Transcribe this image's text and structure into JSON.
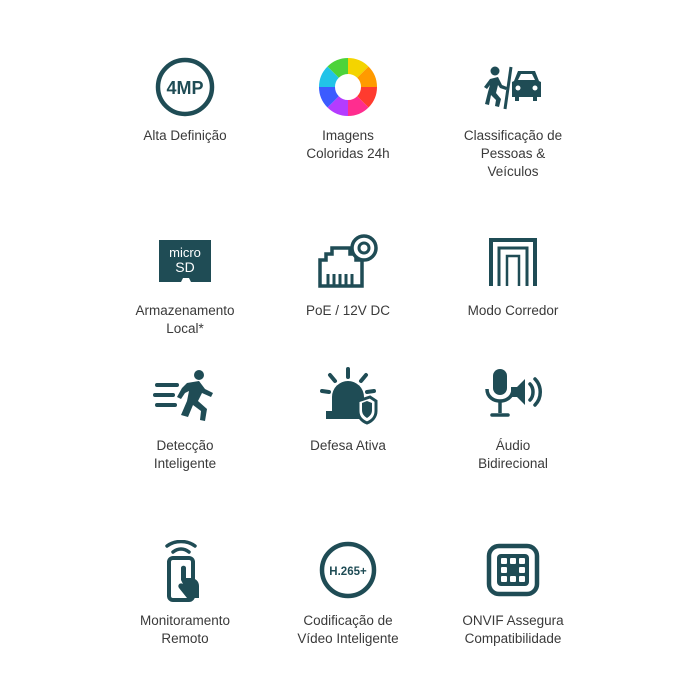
{
  "theme": {
    "icon_color": "#1f4c55"
  },
  "features": [
    {
      "label": "Alta Definição",
      "icon": "4mp-icon",
      "icon_text": "4MP"
    },
    {
      "label": "Imagens\nColoridas 24h",
      "icon": "color-wheel-icon"
    },
    {
      "label": "Classificação de\nPessoas &\nVeículos",
      "icon": "person-vehicle-icon"
    },
    {
      "label": "Armazenamento\nLocal*",
      "icon": "microsd-icon",
      "icon_text_1": "micro",
      "icon_text_2": "SD"
    },
    {
      "label": "PoE / 12V DC",
      "icon": "ethernet-port-icon"
    },
    {
      "label": "Modo Corredor",
      "icon": "corridor-icon"
    },
    {
      "label": "Detecção\nInteligente",
      "icon": "running-person-icon"
    },
    {
      "label": "Defesa Ativa",
      "icon": "alarm-siren-icon"
    },
    {
      "label": "Áudio\nBidirecional",
      "icon": "microphone-speaker-icon"
    },
    {
      "label": "Monitoramento\nRemoto",
      "icon": "phone-signal-icon"
    },
    {
      "label": "Codificação de\nVídeo Inteligente",
      "icon": "h265-icon",
      "icon_text": "H.265+"
    },
    {
      "label": "ONVIF Assegura\nCompatibilidade",
      "icon": "onvif-chip-icon"
    }
  ]
}
